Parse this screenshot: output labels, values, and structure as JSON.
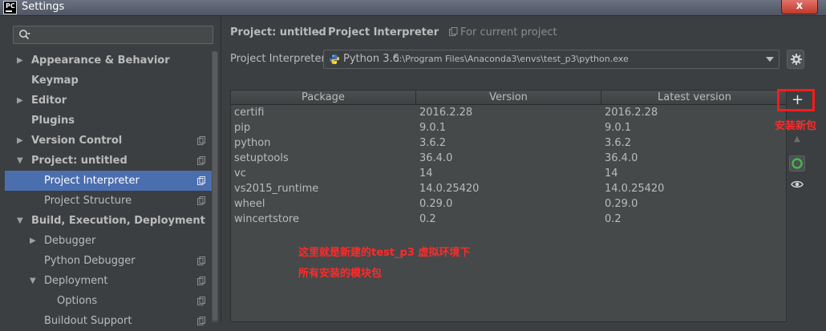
{
  "window": {
    "title": "Settings",
    "app_icon_text": "PC",
    "close_label": "x"
  },
  "search": {
    "placeholder": "Q▾"
  },
  "tree": {
    "items": [
      {
        "label": "Appearance & Behavior",
        "arrow": "▶",
        "bold": true
      },
      {
        "label": "Keymap",
        "arrow": "",
        "bold": true
      },
      {
        "label": "Editor",
        "arrow": "▶",
        "bold": true
      },
      {
        "label": "Plugins",
        "arrow": "",
        "bold": true
      },
      {
        "label": "Version Control",
        "arrow": "▶",
        "bold": true
      },
      {
        "label": "Project: untitled",
        "arrow": "▼",
        "bold": true
      },
      {
        "label": "Project Interpreter",
        "arrow": "",
        "bold": false
      },
      {
        "label": "Project Structure",
        "arrow": "",
        "bold": false
      },
      {
        "label": "Build, Execution, Deployment",
        "arrow": "▼",
        "bold": true
      },
      {
        "label": "Debugger",
        "arrow": "▶",
        "bold": false
      },
      {
        "label": "Python Debugger",
        "arrow": "",
        "bold": false
      },
      {
        "label": "Deployment",
        "arrow": "▼",
        "bold": false
      },
      {
        "label": "Options",
        "arrow": "",
        "bold": false
      },
      {
        "label": "Buildout Support",
        "arrow": "",
        "bold": false
      }
    ]
  },
  "breadcrumb": {
    "parent": "Project: untitled",
    "sep": "›",
    "current": "Project Interpreter",
    "scope": "For current project"
  },
  "interpreter": {
    "label": "Project Interpreter:",
    "name": "Python 3.6",
    "path": "C:\\Program Files\\Anaconda3\\envs\\test_p3\\python.exe"
  },
  "table": {
    "columns": [
      "Package",
      "Version",
      "Latest version"
    ],
    "rows": [
      [
        "certifi",
        "2016.2.28",
        "2016.2.28"
      ],
      [
        "pip",
        "9.0.1",
        "9.0.1"
      ],
      [
        "python",
        "3.6.2",
        "3.6.2"
      ],
      [
        "setuptools",
        "36.4.0",
        "36.4.0"
      ],
      [
        "vc",
        "14",
        "14"
      ],
      [
        "vs2015_runtime",
        "14.0.25420",
        "14.0.25420"
      ],
      [
        "wheel",
        "0.29.0",
        "0.29.0"
      ],
      [
        "wincertstore",
        "0.2",
        "0.2"
      ]
    ]
  },
  "toolbar": {
    "add": "+",
    "up": "▲"
  },
  "annotations": {
    "install_new": "安装新包",
    "note_line1": "这里就是新建的test_p3 虚拟环境下",
    "note_line2": "所有安装的模块包"
  },
  "colors": {
    "accent_selected": "#4b6eaf",
    "annotation_red": "#ff2a2a"
  }
}
